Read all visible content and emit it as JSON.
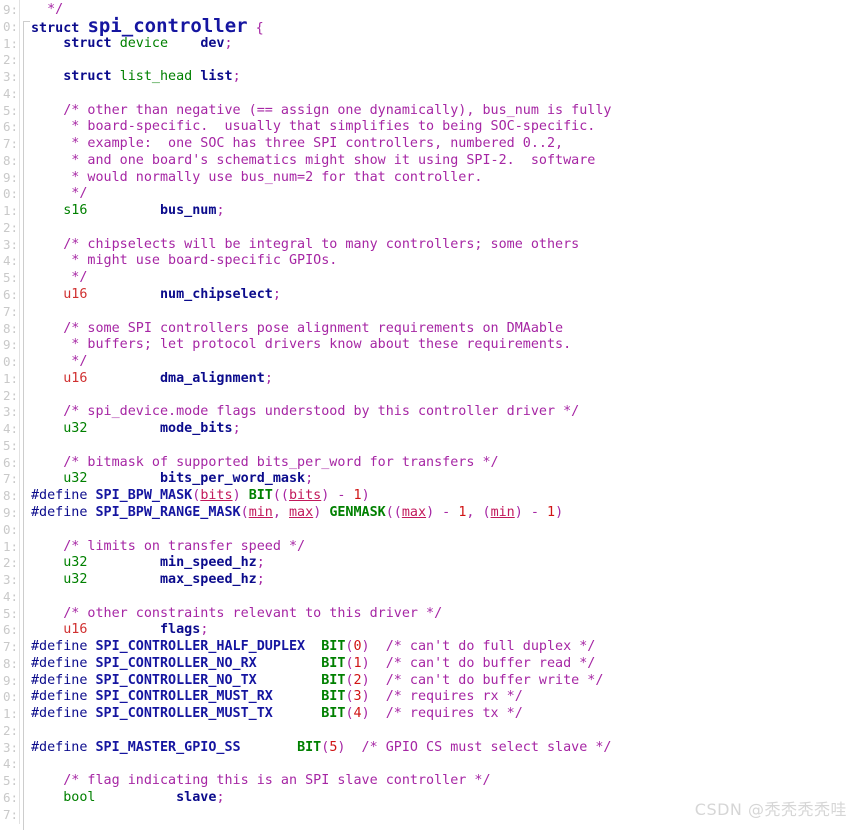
{
  "editor": {
    "language": "C",
    "background_color": "#ffffff",
    "gutter_color": "#c9c9c9",
    "first_visible_line_digit": "9",
    "line_count": 49
  },
  "theme": {
    "comment": "#a626a4",
    "keyword": "#0b0b8c",
    "type_green": "#008000",
    "type_red": "#d03030",
    "identifier": "#0b0b8c",
    "macro_name": "#1515a0",
    "function": "#008000",
    "number": "#d01414",
    "parameter": "#c2185b",
    "punctuation": "#a626a4"
  },
  "watermark": {
    "text": "CSDN @秃秃秃秃哇",
    "color": "#d6d6d6"
  },
  "gutter": {
    "digits": [
      "9",
      "0",
      "1",
      "2",
      "3",
      "4",
      "5",
      "6",
      "7",
      "8",
      "9",
      "0",
      "1",
      "2",
      "3",
      "4",
      "5",
      "6",
      "7",
      "8",
      "9",
      "0",
      "1",
      "2",
      "3",
      "4",
      "5",
      "6",
      "7",
      "8",
      "9",
      "0",
      "1",
      "2",
      "3",
      "4",
      "5",
      "6",
      "7",
      "8",
      "9",
      "0",
      "1",
      "2",
      "3",
      "4",
      "5",
      "6",
      "7"
    ]
  },
  "code": {
    "lines": [
      {
        "i": 0,
        "tokens": [
          {
            "t": "  ",
            "c": "plain"
          },
          {
            "t": "*/",
            "c": "comment"
          }
        ]
      },
      {
        "i": 1,
        "structhead": true,
        "tokens": [
          {
            "t": "struct ",
            "c": "keyword"
          },
          {
            "t": "spi_controller",
            "c": "structname"
          },
          {
            "t": " {",
            "c": "punct"
          }
        ]
      },
      {
        "i": 2,
        "tokens": [
          {
            "t": "    ",
            "c": "plain"
          },
          {
            "t": "struct",
            "c": "keyword"
          },
          {
            "t": " ",
            "c": "plain"
          },
          {
            "t": "device",
            "c": "type"
          },
          {
            "t": "    ",
            "c": "plain"
          },
          {
            "t": "dev",
            "c": "ident"
          },
          {
            "t": ";",
            "c": "punct"
          }
        ]
      },
      {
        "i": 3,
        "tokens": []
      },
      {
        "i": 4,
        "tokens": [
          {
            "t": "    ",
            "c": "plain"
          },
          {
            "t": "struct",
            "c": "keyword"
          },
          {
            "t": " ",
            "c": "plain"
          },
          {
            "t": "list_head",
            "c": "type"
          },
          {
            "t": " ",
            "c": "plain"
          },
          {
            "t": "list",
            "c": "ident"
          },
          {
            "t": ";",
            "c": "punct"
          }
        ]
      },
      {
        "i": 5,
        "tokens": []
      },
      {
        "i": 6,
        "tokens": [
          {
            "t": "    /* other than negative (== assign one dynamically), bus_num is fully",
            "c": "comment"
          }
        ]
      },
      {
        "i": 7,
        "tokens": [
          {
            "t": "     * board-specific.  usually that simplifies to being SOC-specific.",
            "c": "comment"
          }
        ]
      },
      {
        "i": 8,
        "tokens": [
          {
            "t": "     * example:  one SOC has three SPI controllers, numbered 0..2,",
            "c": "comment"
          }
        ]
      },
      {
        "i": 9,
        "tokens": [
          {
            "t": "     * and one board's schematics might show it using SPI-2.  software",
            "c": "comment"
          }
        ]
      },
      {
        "i": 10,
        "tokens": [
          {
            "t": "     * would normally use bus_num=2 for that controller.",
            "c": "comment"
          }
        ]
      },
      {
        "i": 11,
        "tokens": [
          {
            "t": "     */",
            "c": "comment"
          }
        ]
      },
      {
        "i": 12,
        "tokens": [
          {
            "t": "    ",
            "c": "plain"
          },
          {
            "t": "s16",
            "c": "type"
          },
          {
            "t": "         ",
            "c": "plain"
          },
          {
            "t": "bus_num",
            "c": "ident"
          },
          {
            "t": ";",
            "c": "punct"
          }
        ]
      },
      {
        "i": 13,
        "tokens": []
      },
      {
        "i": 14,
        "tokens": [
          {
            "t": "    /* chipselects will be integral to many controllers; some others",
            "c": "comment"
          }
        ]
      },
      {
        "i": 15,
        "tokens": [
          {
            "t": "     * might use board-specific GPIOs.",
            "c": "comment"
          }
        ]
      },
      {
        "i": 16,
        "tokens": [
          {
            "t": "     */",
            "c": "comment"
          }
        ]
      },
      {
        "i": 17,
        "tokens": [
          {
            "t": "    ",
            "c": "plain"
          },
          {
            "t": "u16",
            "c": "type-r"
          },
          {
            "t": "         ",
            "c": "plain"
          },
          {
            "t": "num_chipselect",
            "c": "ident"
          },
          {
            "t": ";",
            "c": "punct"
          }
        ]
      },
      {
        "i": 18,
        "tokens": []
      },
      {
        "i": 19,
        "tokens": [
          {
            "t": "    /* some SPI controllers pose alignment requirements on DMAable",
            "c": "comment"
          }
        ]
      },
      {
        "i": 20,
        "tokens": [
          {
            "t": "     * buffers; let protocol drivers know about these requirements.",
            "c": "comment"
          }
        ]
      },
      {
        "i": 21,
        "tokens": [
          {
            "t": "     */",
            "c": "comment"
          }
        ]
      },
      {
        "i": 22,
        "tokens": [
          {
            "t": "    ",
            "c": "plain"
          },
          {
            "t": "u16",
            "c": "type-r"
          },
          {
            "t": "         ",
            "c": "plain"
          },
          {
            "t": "dma_alignment",
            "c": "ident"
          },
          {
            "t": ";",
            "c": "punct"
          }
        ]
      },
      {
        "i": 23,
        "tokens": []
      },
      {
        "i": 24,
        "tokens": [
          {
            "t": "    /* spi_device.mode flags understood by this controller driver */",
            "c": "comment"
          }
        ]
      },
      {
        "i": 25,
        "tokens": [
          {
            "t": "    ",
            "c": "plain"
          },
          {
            "t": "u32",
            "c": "type"
          },
          {
            "t": "         ",
            "c": "plain"
          },
          {
            "t": "mode_bits",
            "c": "ident"
          },
          {
            "t": ";",
            "c": "punct"
          }
        ]
      },
      {
        "i": 26,
        "tokens": []
      },
      {
        "i": 27,
        "tokens": [
          {
            "t": "    /* bitmask of supported bits_per_word for transfers */",
            "c": "comment"
          }
        ]
      },
      {
        "i": 28,
        "tokens": [
          {
            "t": "    ",
            "c": "plain"
          },
          {
            "t": "u32",
            "c": "type"
          },
          {
            "t": "         ",
            "c": "plain"
          },
          {
            "t": "bits_per_word_mask",
            "c": "ident"
          },
          {
            "t": ";",
            "c": "punct"
          }
        ]
      },
      {
        "i": 29,
        "tokens": [
          {
            "t": "#define ",
            "c": "directive"
          },
          {
            "t": "SPI_BPW_MASK",
            "c": "macro"
          },
          {
            "t": "(",
            "c": "punct"
          },
          {
            "t": "bits",
            "c": "param"
          },
          {
            "t": ") ",
            "c": "punct"
          },
          {
            "t": "BIT",
            "c": "func"
          },
          {
            "t": "((",
            "c": "punct"
          },
          {
            "t": "bits",
            "c": "param2"
          },
          {
            "t": ") - ",
            "c": "punct"
          },
          {
            "t": "1",
            "c": "number"
          },
          {
            "t": ")",
            "c": "punct"
          }
        ]
      },
      {
        "i": 30,
        "tokens": [
          {
            "t": "#define ",
            "c": "directive"
          },
          {
            "t": "SPI_BPW_RANGE_MASK",
            "c": "macro"
          },
          {
            "t": "(",
            "c": "punct"
          },
          {
            "t": "min",
            "c": "param"
          },
          {
            "t": ", ",
            "c": "punct"
          },
          {
            "t": "max",
            "c": "param"
          },
          {
            "t": ") ",
            "c": "punct"
          },
          {
            "t": "GENMASK",
            "c": "func"
          },
          {
            "t": "((",
            "c": "punct"
          },
          {
            "t": "max",
            "c": "param2"
          },
          {
            "t": ") - ",
            "c": "punct"
          },
          {
            "t": "1",
            "c": "number"
          },
          {
            "t": ", (",
            "c": "punct"
          },
          {
            "t": "min",
            "c": "param2"
          },
          {
            "t": ") - ",
            "c": "punct"
          },
          {
            "t": "1",
            "c": "number"
          },
          {
            "t": ")",
            "c": "punct"
          }
        ]
      },
      {
        "i": 31,
        "tokens": []
      },
      {
        "i": 32,
        "tokens": [
          {
            "t": "    /* limits on transfer speed */",
            "c": "comment"
          }
        ]
      },
      {
        "i": 33,
        "tokens": [
          {
            "t": "    ",
            "c": "plain"
          },
          {
            "t": "u32",
            "c": "type"
          },
          {
            "t": "         ",
            "c": "plain"
          },
          {
            "t": "min_speed_hz",
            "c": "ident"
          },
          {
            "t": ";",
            "c": "punct"
          }
        ]
      },
      {
        "i": 34,
        "tokens": [
          {
            "t": "    ",
            "c": "plain"
          },
          {
            "t": "u32",
            "c": "type"
          },
          {
            "t": "         ",
            "c": "plain"
          },
          {
            "t": "max_speed_hz",
            "c": "ident"
          },
          {
            "t": ";",
            "c": "punct"
          }
        ]
      },
      {
        "i": 35,
        "tokens": []
      },
      {
        "i": 36,
        "tokens": [
          {
            "t": "    /* other constraints relevant to this driver */",
            "c": "comment"
          }
        ]
      },
      {
        "i": 37,
        "tokens": [
          {
            "t": "    ",
            "c": "plain"
          },
          {
            "t": "u16",
            "c": "type-r"
          },
          {
            "t": "         ",
            "c": "plain"
          },
          {
            "t": "flags",
            "c": "ident"
          },
          {
            "t": ";",
            "c": "punct"
          }
        ]
      },
      {
        "i": 38,
        "tokens": [
          {
            "t": "#define ",
            "c": "directive"
          },
          {
            "t": "SPI_CONTROLLER_HALF_DUPLEX",
            "c": "macro"
          },
          {
            "t": "  ",
            "c": "plain"
          },
          {
            "t": "BIT",
            "c": "func"
          },
          {
            "t": "(",
            "c": "punct"
          },
          {
            "t": "0",
            "c": "number"
          },
          {
            "t": ")",
            "c": "punct"
          },
          {
            "t": "  /* can't do full duplex */",
            "c": "comment"
          }
        ]
      },
      {
        "i": 39,
        "tokens": [
          {
            "t": "#define ",
            "c": "directive"
          },
          {
            "t": "SPI_CONTROLLER_NO_RX",
            "c": "macro"
          },
          {
            "t": "        ",
            "c": "plain"
          },
          {
            "t": "BIT",
            "c": "func"
          },
          {
            "t": "(",
            "c": "punct"
          },
          {
            "t": "1",
            "c": "number"
          },
          {
            "t": ")",
            "c": "punct"
          },
          {
            "t": "  /* can't do buffer read */",
            "c": "comment"
          }
        ]
      },
      {
        "i": 40,
        "tokens": [
          {
            "t": "#define ",
            "c": "directive"
          },
          {
            "t": "SPI_CONTROLLER_NO_TX",
            "c": "macro"
          },
          {
            "t": "        ",
            "c": "plain"
          },
          {
            "t": "BIT",
            "c": "func"
          },
          {
            "t": "(",
            "c": "punct"
          },
          {
            "t": "2",
            "c": "number"
          },
          {
            "t": ")",
            "c": "punct"
          },
          {
            "t": "  /* can't do buffer write */",
            "c": "comment"
          }
        ]
      },
      {
        "i": 41,
        "tokens": [
          {
            "t": "#define ",
            "c": "directive"
          },
          {
            "t": "SPI_CONTROLLER_MUST_RX",
            "c": "macro"
          },
          {
            "t": "      ",
            "c": "plain"
          },
          {
            "t": "BIT",
            "c": "func"
          },
          {
            "t": "(",
            "c": "punct"
          },
          {
            "t": "3",
            "c": "number"
          },
          {
            "t": ")",
            "c": "punct"
          },
          {
            "t": "  /* requires rx */",
            "c": "comment"
          }
        ]
      },
      {
        "i": 42,
        "tokens": [
          {
            "t": "#define ",
            "c": "directive"
          },
          {
            "t": "SPI_CONTROLLER_MUST_TX",
            "c": "macro"
          },
          {
            "t": "      ",
            "c": "plain"
          },
          {
            "t": "BIT",
            "c": "func"
          },
          {
            "t": "(",
            "c": "punct"
          },
          {
            "t": "4",
            "c": "number"
          },
          {
            "t": ")",
            "c": "punct"
          },
          {
            "t": "  /* requires tx */",
            "c": "comment"
          }
        ]
      },
      {
        "i": 43,
        "tokens": []
      },
      {
        "i": 44,
        "tokens": [
          {
            "t": "#define ",
            "c": "directive"
          },
          {
            "t": "SPI_MASTER_GPIO_SS",
            "c": "macro"
          },
          {
            "t": "       ",
            "c": "plain"
          },
          {
            "t": "BIT",
            "c": "func"
          },
          {
            "t": "(",
            "c": "punct"
          },
          {
            "t": "5",
            "c": "number"
          },
          {
            "t": ")",
            "c": "punct"
          },
          {
            "t": "  /* GPIO CS must select slave */",
            "c": "comment"
          }
        ]
      },
      {
        "i": 45,
        "tokens": []
      },
      {
        "i": 46,
        "tokens": [
          {
            "t": "    /* flag indicating this is an SPI slave controller */",
            "c": "comment"
          }
        ]
      },
      {
        "i": 47,
        "tokens": [
          {
            "t": "    ",
            "c": "plain"
          },
          {
            "t": "bool",
            "c": "type"
          },
          {
            "t": "          ",
            "c": "plain"
          },
          {
            "t": "slave",
            "c": "ident"
          },
          {
            "t": ";",
            "c": "punct"
          }
        ]
      },
      {
        "i": 48,
        "tokens": []
      }
    ]
  }
}
